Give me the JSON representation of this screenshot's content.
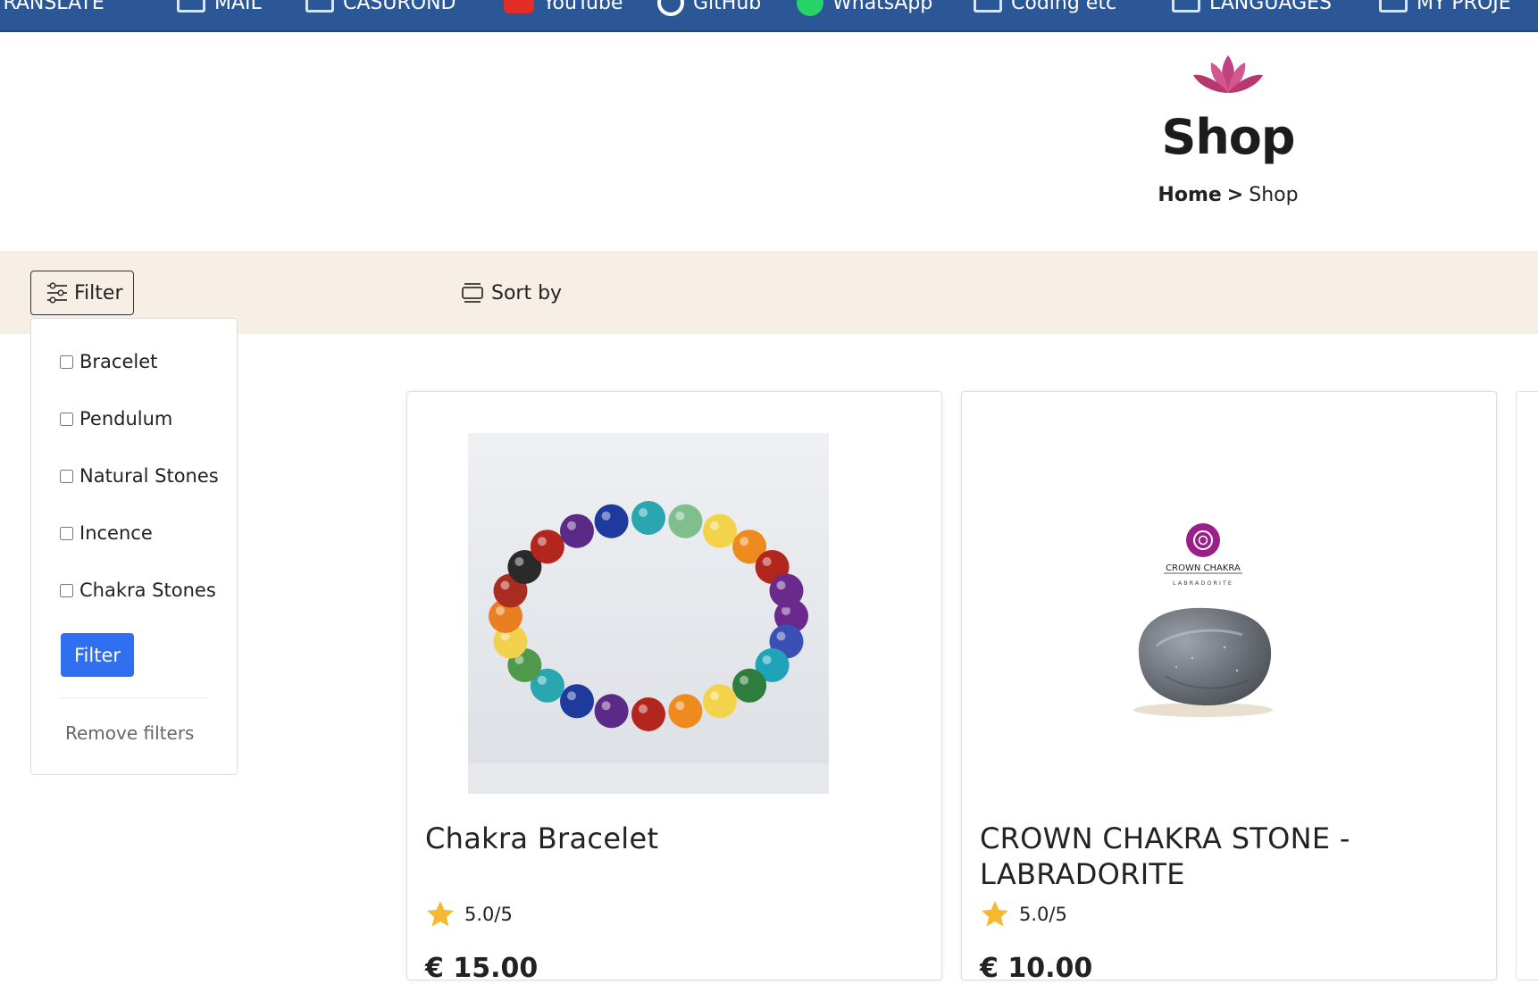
{
  "bookmarks": [
    {
      "label": "TRANSLATE",
      "icon": "folder-icon"
    },
    {
      "label": "MAIL",
      "icon": "folder-icon"
    },
    {
      "label": "CASUROND",
      "icon": "folder-icon"
    },
    {
      "label": "YouTube",
      "icon": "youtube-icon"
    },
    {
      "label": "GitHub",
      "icon": "github-icon"
    },
    {
      "label": "WhatsApp",
      "icon": "whatsapp-icon"
    },
    {
      "label": "Coding etc",
      "icon": "folder-icon"
    },
    {
      "label": "LANGUAGES",
      "icon": "folder-icon"
    },
    {
      "label": "MY PROJE",
      "icon": "folder-icon"
    }
  ],
  "header": {
    "logo_icon": "lotus-icon",
    "title": "Shop",
    "breadcrumb": {
      "home": "Home",
      "separator": ">",
      "current": "Shop"
    }
  },
  "toolbar": {
    "filter_label": "Filter",
    "sort_label": "Sort by",
    "background": "#f7efe5"
  },
  "filter_panel": {
    "options": [
      "Bracelet",
      "Pendulum",
      "Natural Stones",
      "Incence",
      "Chakra Stones"
    ],
    "apply_label": "Filter",
    "remove_label": "Remove filters",
    "accent": "#2f6ff0"
  },
  "products": [
    {
      "name": "Chakra Bracelet",
      "rating": "5.0/5",
      "price": "€ 15.00",
      "image": "chakra-bracelet-photo"
    },
    {
      "name": "CROWN CHAKRA STONE - LABRADORITE",
      "rating": "5.0/5",
      "price": "€ 10.00",
      "image": "labradorite-stone-photo",
      "image_caption": {
        "title": "CROWN CHAKRA",
        "subtitle": "LABRADORITE"
      }
    }
  ],
  "colors": {
    "bookmark_bar": "#2b5797",
    "star": "#f5b82e",
    "lotus": "#c2407e"
  }
}
